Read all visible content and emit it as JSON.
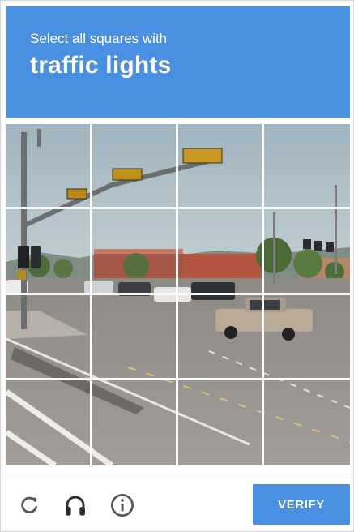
{
  "challenge": {
    "prompt": "Select all squares with",
    "target_object": "traffic lights"
  },
  "grid": {
    "rows": 4,
    "columns": 4
  },
  "footer": {
    "reload_icon": "reload-icon",
    "audio_icon": "headphones-icon",
    "info_icon": "info-icon",
    "verify_label": "VERIFY"
  },
  "colors": {
    "accent": "#4a90e2"
  }
}
